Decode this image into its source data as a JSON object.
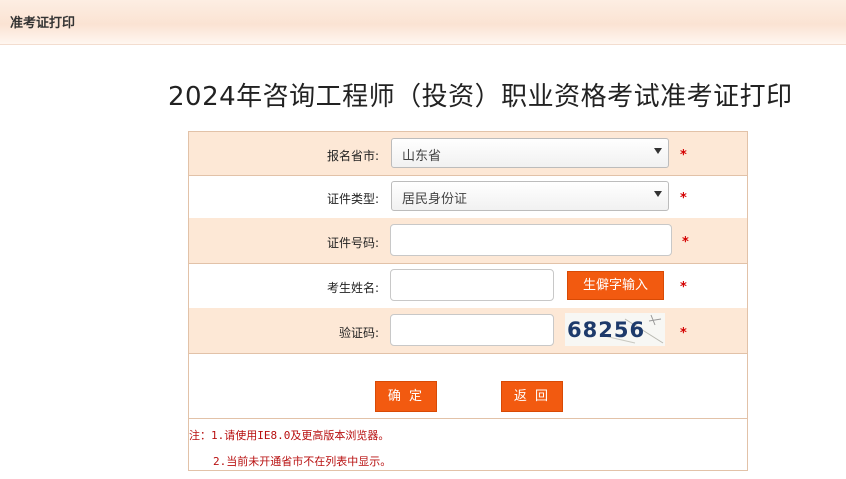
{
  "header": {
    "title": "准考证打印"
  },
  "page": {
    "title": "2024年咨询工程师（投资）职业资格考试准考证打印"
  },
  "form": {
    "province": {
      "label": "报名省市:",
      "value": "山东省"
    },
    "id_type": {
      "label": "证件类型:",
      "value": "居民身份证"
    },
    "id_number": {
      "label": "证件号码:",
      "value": ""
    },
    "name": {
      "label": "考生姓名:",
      "value": "",
      "rare_char_button": "生僻字输入"
    },
    "captcha": {
      "label": "验证码:",
      "value": "",
      "image_text": "68256"
    },
    "required_mark": "*",
    "confirm_label": "确 定",
    "back_label": "返 回"
  },
  "notes": [
    "注：1.请使用IE8.0及更高版本浏览器。",
    "2.当前未开通省市不在列表中显示。"
  ],
  "colors": {
    "accent": "#f25a10",
    "row_shade": "#fde8d6",
    "border": "#e2c2a8",
    "required": "#d40000"
  }
}
